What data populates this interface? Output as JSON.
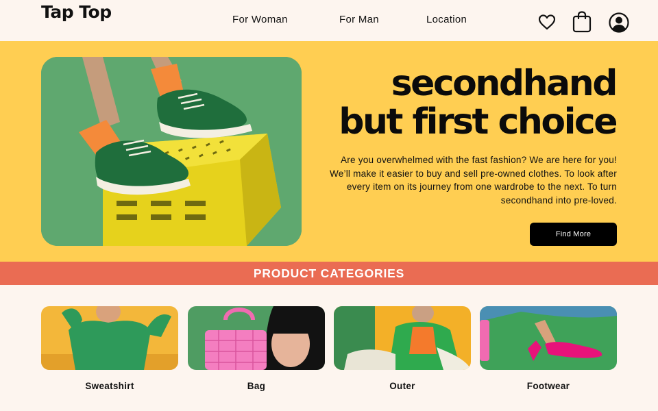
{
  "header": {
    "brand": "Tap Top",
    "nav": [
      {
        "label": "For Woman"
      },
      {
        "label": "For Man"
      },
      {
        "label": "Location"
      }
    ],
    "icons": [
      "heart-icon",
      "shopping-bag-icon",
      "user-account-icon"
    ]
  },
  "hero": {
    "title_line1": "secondhand",
    "title_line2": "but first choice",
    "description": "Are you overwhelmed with the fast fashion? We are here for you! We’ll make it easier to buy and sell pre-owned clothes. To look after every item on its journey from one wardrobe to the next. To turn secondhand into pre-loved.",
    "cta_label": "Find More"
  },
  "categories": {
    "heading": "PRODUCT CATEGORIES",
    "items": [
      {
        "label": "Sweatshirt"
      },
      {
        "label": "Bag"
      },
      {
        "label": "Outer"
      },
      {
        "label": "Footwear"
      }
    ]
  },
  "colors": {
    "page_bg": "#fdf5ef",
    "hero_bg": "#ffce52",
    "banner_bg": "#ea6c53",
    "button_bg": "#000000",
    "text": "#111111"
  }
}
